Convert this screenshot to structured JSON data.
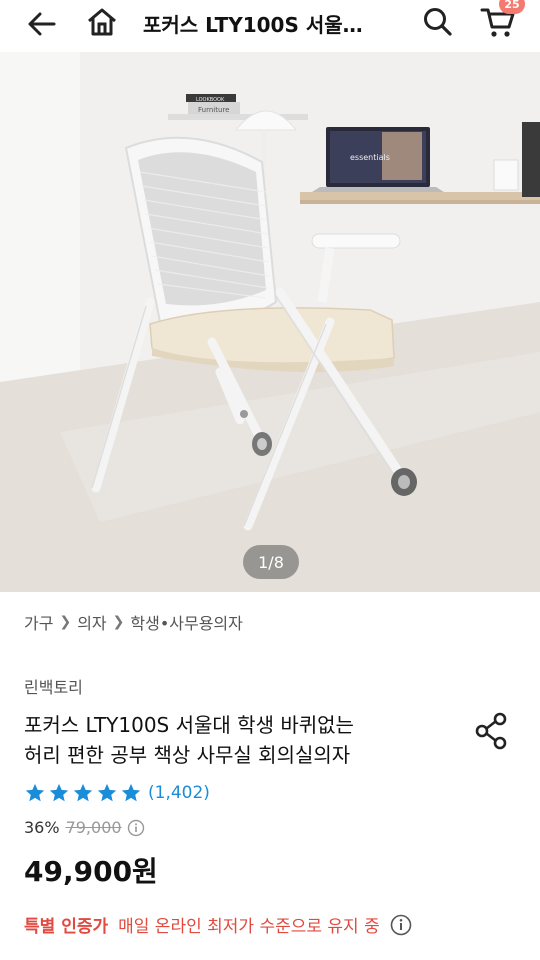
{
  "header": {
    "title": "포커스 LTY100S 서울…",
    "cart_count": "25"
  },
  "hero": {
    "pager": "1/8",
    "book_text_1": "LOOKBOOK",
    "book_text_2": "Furniture",
    "laptop_text": "essentials"
  },
  "breadcrumb": [
    "가구",
    "의자",
    "학생•사무용의자"
  ],
  "product": {
    "seller": "린백토리",
    "name_line1": "포커스 LTY100S 서울대 학생 바퀴없는",
    "name_line2": "허리 편한 공부 책상 사무실 회의실의자",
    "rating": 5,
    "review_count": "(1,402)",
    "discount": "36%",
    "original_price": "79,000",
    "price": "49,900원",
    "promo_badge": "특별 인증가",
    "promo_text": "매일 온라인 최저가 수준으로 유지 중"
  },
  "colors": {
    "accent_blue": "#1a8cd8",
    "promo_red": "#e14a3f",
    "badge": "#f4796e"
  }
}
